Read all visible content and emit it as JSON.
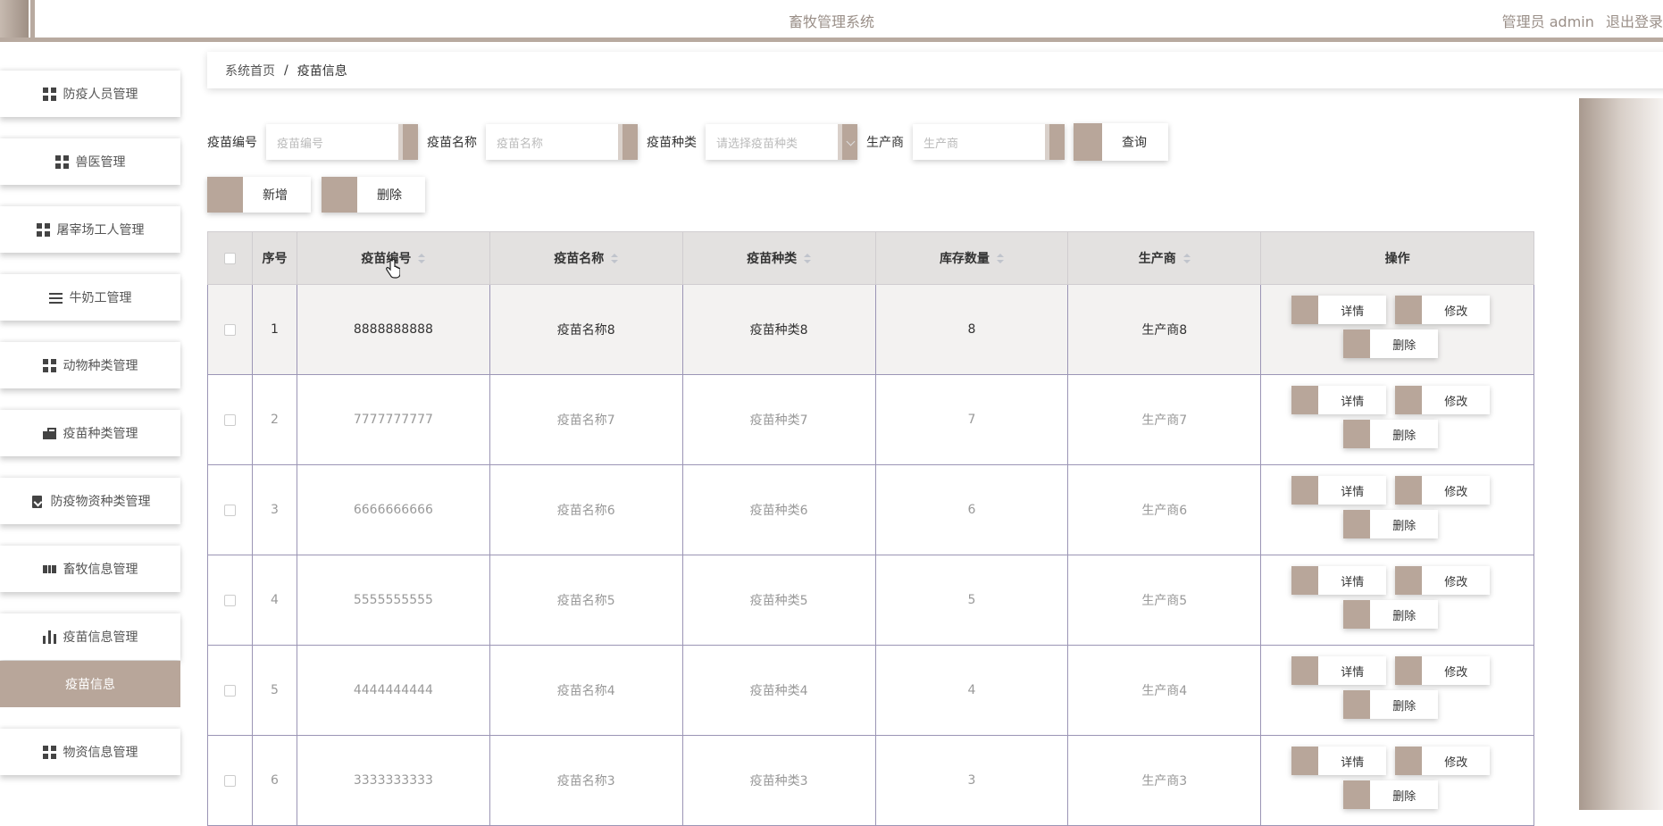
{
  "header": {
    "title": "畜牧管理系统",
    "user_label": "管理员 admin",
    "logout_label": "退出登录"
  },
  "sidebar": {
    "items": [
      {
        "label": "防疫人员管理",
        "icon": "grid-icon"
      },
      {
        "label": "兽医管理",
        "icon": "grid-icon"
      },
      {
        "label": "屠宰场工人管理",
        "icon": "grid-icon"
      },
      {
        "label": "牛奶工管理",
        "icon": "list-icon"
      },
      {
        "label": "动物种类管理",
        "icon": "grid-icon"
      },
      {
        "label": "疫苗种类管理",
        "icon": "briefcase-icon"
      },
      {
        "label": "防疫物资种类管理",
        "icon": "clipboard-icon"
      },
      {
        "label": "畜牧信息管理",
        "icon": "bowtie-icon"
      },
      {
        "label": "疫苗信息管理",
        "icon": "bar-chart-icon"
      },
      {
        "label": "物资信息管理",
        "icon": "grid-icon"
      }
    ],
    "active_sub": "疫苗信息"
  },
  "breadcrumb": {
    "home": "系统首页",
    "separator": "/",
    "current": "疫苗信息"
  },
  "search": {
    "code_label": "疫苗编号",
    "code_placeholder": "疫苗编号",
    "name_label": "疫苗名称",
    "name_placeholder": "疫苗名称",
    "type_label": "疫苗种类",
    "type_placeholder": "请选择疫苗种类",
    "maker_label": "生产商",
    "maker_placeholder": "生产商",
    "query_label": "查询"
  },
  "actions": {
    "add_label": "新增",
    "delete_label": "删除"
  },
  "table": {
    "headers": [
      "序号",
      "疫苗编号",
      "疫苗名称",
      "疫苗种类",
      "库存数量",
      "生产商",
      "操作"
    ],
    "rows": [
      {
        "index": "1",
        "code": "8888888888",
        "name": "疫苗名称8",
        "type": "疫苗种类8",
        "stock": "8",
        "maker": "生产商8"
      },
      {
        "index": "2",
        "code": "7777777777",
        "name": "疫苗名称7",
        "type": "疫苗种类7",
        "stock": "7",
        "maker": "生产商7"
      },
      {
        "index": "3",
        "code": "6666666666",
        "name": "疫苗名称6",
        "type": "疫苗种类6",
        "stock": "6",
        "maker": "生产商6"
      },
      {
        "index": "4",
        "code": "5555555555",
        "name": "疫苗名称5",
        "type": "疫苗种类5",
        "stock": "5",
        "maker": "生产商5"
      },
      {
        "index": "5",
        "code": "4444444444",
        "name": "疫苗名称4",
        "type": "疫苗种类4",
        "stock": "4",
        "maker": "生产商4"
      },
      {
        "index": "6",
        "code": "3333333333",
        "name": "疫苗名称3",
        "type": "疫苗种类3",
        "stock": "3",
        "maker": "生产商3"
      }
    ],
    "op_detail": "详情",
    "op_edit": "修改",
    "op_delete": "删除"
  },
  "colors": {
    "accent": "#b8a69a",
    "header_bg": "#e3e1e0",
    "row_border": "#9b95b5"
  }
}
